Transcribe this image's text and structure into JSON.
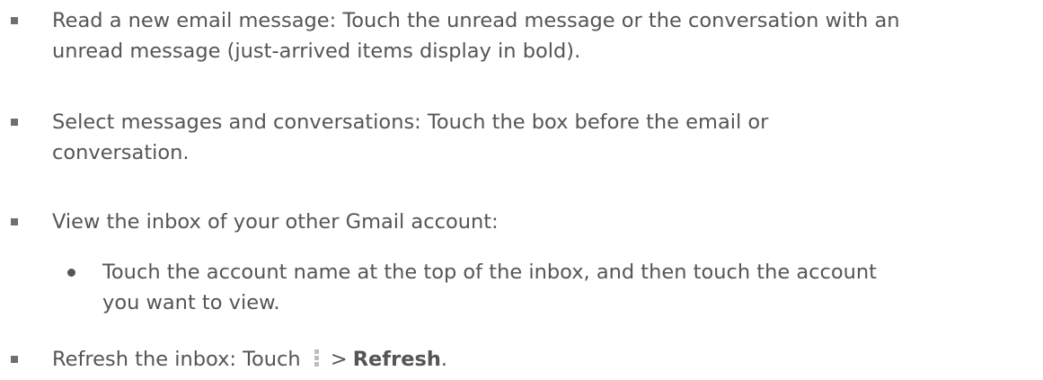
{
  "items": [
    {
      "line1": "Read a new email message: Touch the unread message or the conversation with an",
      "line2": "unread message (just-arrived items display in bold)."
    },
    {
      "line1": "Select messages and conversations: Touch the box before the email or",
      "line2": "conversation."
    },
    {
      "line1": "View the inbox of your other Gmail account:"
    }
  ],
  "sub_item": {
    "line1": "Touch the account name at the top of the inbox, and then touch the account",
    "line2": "you want to view."
  },
  "refresh_item": {
    "prefix": "Refresh the inbox: Touch",
    "icon": "overflow-menu-icon",
    "separator": ">",
    "action": "Refresh",
    "suffix": "."
  }
}
